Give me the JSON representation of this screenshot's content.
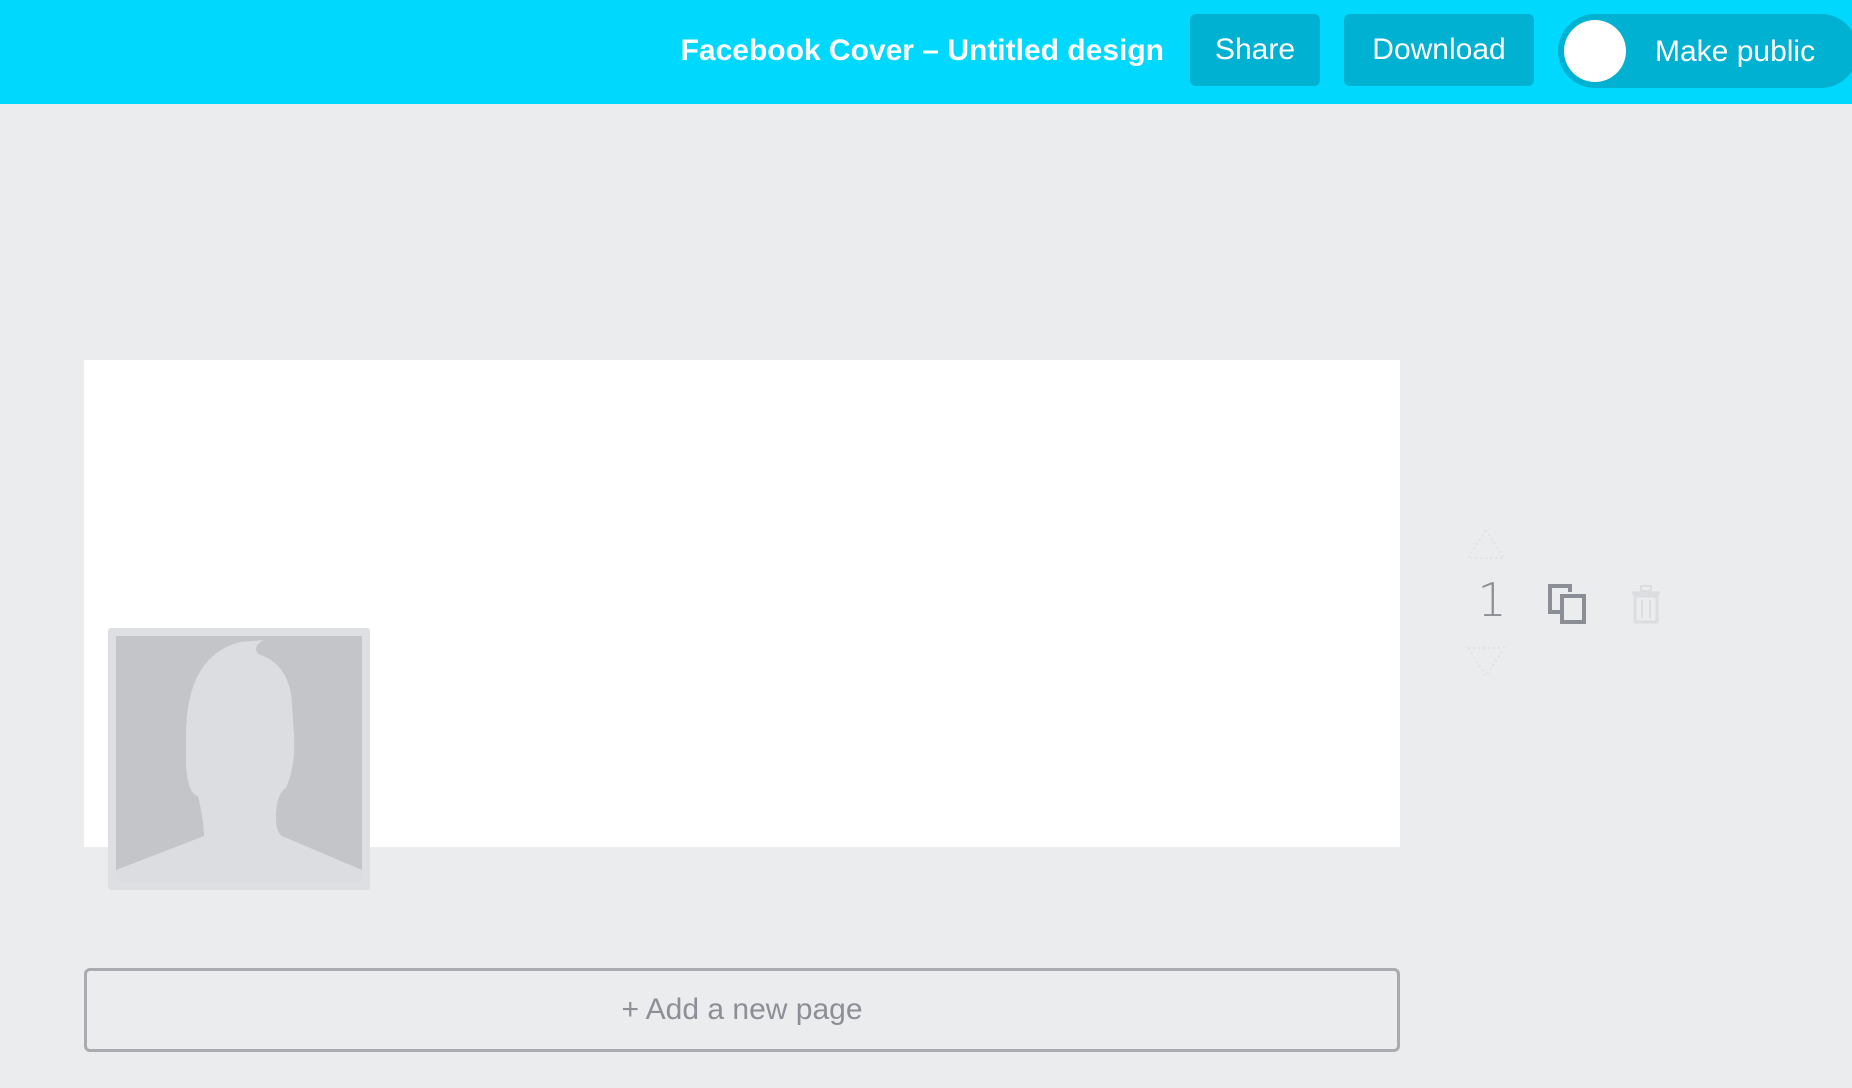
{
  "header": {
    "title": "Facebook Cover – Untitled design",
    "share_label": "Share",
    "download_label": "Download",
    "make_public_label": "Make public",
    "make_public_enabled": false
  },
  "page_controls": {
    "page_number": "1",
    "move_up_enabled": false,
    "move_down_enabled": false,
    "delete_enabled": false
  },
  "add_page_label": "+ Add a new page",
  "colors": {
    "header_bg": "#00d9fd",
    "button_bg": "#00b1d2",
    "workspace_bg": "#ebecee",
    "canvas_bg": "#ffffff"
  },
  "icons": {
    "move_up": "triangle-up-icon",
    "move_down": "triangle-down-icon",
    "copy": "copy-icon",
    "delete": "trash-icon",
    "profile_placeholder": "profile-silhouette-icon"
  }
}
